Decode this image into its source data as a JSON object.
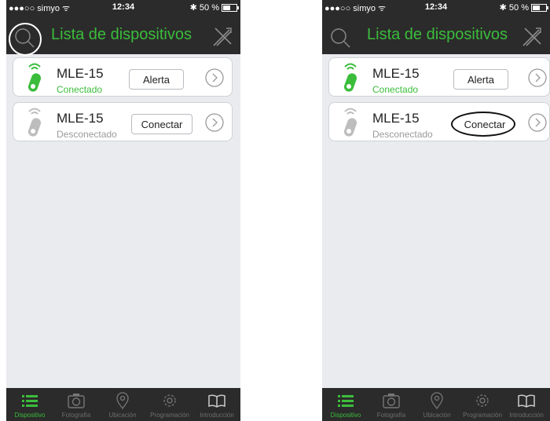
{
  "status": {
    "carrier": "●●●○○ simyo ᯤ",
    "time": "12:34",
    "battery": "✱ 50 %"
  },
  "nav": {
    "title": "Lista de dispositivos"
  },
  "devices": [
    {
      "name": "MLE-15",
      "status": "Conectado",
      "action": "Alerta"
    },
    {
      "name": "MLE-15",
      "status": "Desconectado",
      "action": "Conectar"
    }
  ],
  "tabs": [
    {
      "label": "Dispositivo",
      "icon": "list-icon"
    },
    {
      "label": "Fotografía",
      "icon": "camera-icon"
    },
    {
      "label": "Ubicación",
      "icon": "location-pin-icon"
    },
    {
      "label": "Programación",
      "icon": "gear-icon"
    },
    {
      "label": "Introducción",
      "icon": "book-icon"
    }
  ],
  "colors": {
    "accent": "#3bbd3b",
    "bar": "#2b2b2b",
    "background": "#e9ebef"
  }
}
